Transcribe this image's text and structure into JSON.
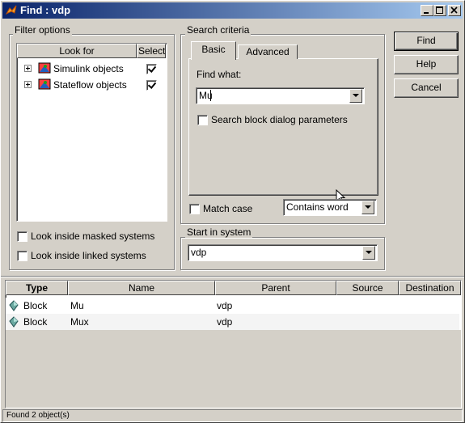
{
  "window": {
    "title": "Find : vdp",
    "minimize_icon": "minimize-icon",
    "maximize_icon": "maximize-icon",
    "close_icon": "close-icon"
  },
  "filter_options": {
    "label": "Filter options",
    "tree_headers": {
      "look_for": "Look for",
      "select": "Select"
    },
    "items": [
      {
        "label": "Simulink objects",
        "checked": true
      },
      {
        "label": "Stateflow objects",
        "checked": true
      }
    ],
    "look_inside_masked": "Look inside masked systems",
    "look_inside_linked": "Look inside linked systems"
  },
  "search_criteria": {
    "label": "Search criteria",
    "tabs": [
      "Basic",
      "Advanced"
    ],
    "active_tab": "Basic",
    "find_what_label": "Find what:",
    "find_what_value": "Mu",
    "search_block_params": "Search block dialog parameters",
    "match_case": "Match case",
    "match_mode": "Contains word"
  },
  "start_in_system": {
    "label": "Start in system",
    "value": "vdp"
  },
  "buttons": {
    "find": "Find",
    "help": "Help",
    "cancel": "Cancel"
  },
  "results": {
    "columns": [
      "Type",
      "Name",
      "Parent",
      "Source",
      "Destination"
    ],
    "rows": [
      {
        "type": "Block",
        "name": "Mu",
        "parent": "vdp",
        "source": "",
        "destination": ""
      },
      {
        "type": "Block",
        "name": "Mux",
        "parent": "vdp",
        "source": "",
        "destination": ""
      }
    ]
  },
  "status": "Found 2 object(s)",
  "colors": {
    "title_gradient_start": "#0a246a",
    "title_gradient_end": "#a6caf0",
    "face": "#d4d0c8"
  }
}
